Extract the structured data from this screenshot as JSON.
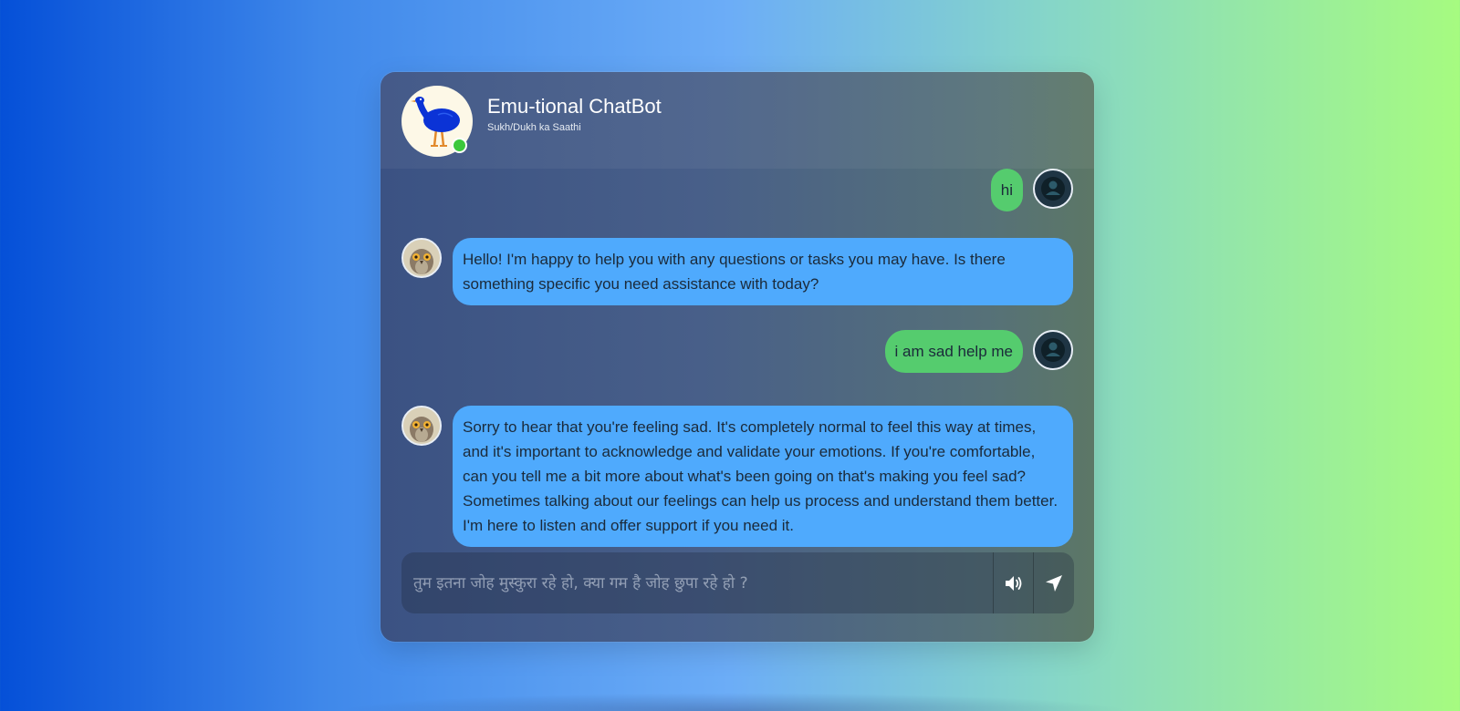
{
  "header": {
    "title": "Emu-tional ChatBot",
    "subtitle": "Sukh/Dukh ka Saathi",
    "status": "online"
  },
  "messages": [
    {
      "sender": "user",
      "text": "hi"
    },
    {
      "sender": "bot",
      "text": "Hello! I'm happy to help you with any questions or tasks you may have. Is there something specific you need assistance with today?"
    },
    {
      "sender": "user",
      "text": "i am sad help me"
    },
    {
      "sender": "bot",
      "text": "Sorry to hear that you're feeling sad. It's completely normal to feel this way at times, and it's important to acknowledge and validate your emotions. If you're comfortable, can you tell me a bit more about what's been going on that's making you feel sad? Sometimes talking about our feelings can help us process and understand them better. I'm here to listen and offer support if you need it."
    }
  ],
  "composer": {
    "placeholder": "तुम इतना जोह मुस्कुरा रहे हो, क्या गम है जोह छुपा रहे हो ?",
    "value": ""
  },
  "icons": {
    "bot_avatar": "emu-icon",
    "user_avatar": "user-icon",
    "speaker": "speaker-icon",
    "send": "send-icon"
  },
  "colors": {
    "user_bubble": "#55cc6e",
    "bot_bubble": "#4faafd",
    "online": "#3cc83c"
  }
}
